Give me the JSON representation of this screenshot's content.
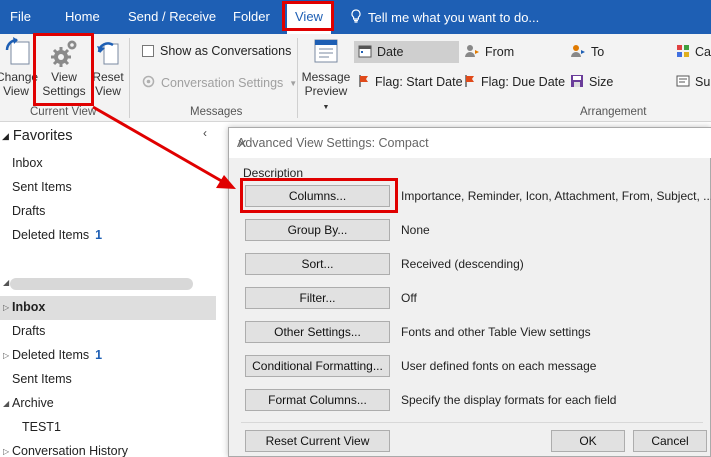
{
  "ribbon_tabs": {
    "file": "File",
    "home": "Home",
    "send_receive": "Send / Receive",
    "folder": "Folder",
    "view": "View",
    "tell_me": "Tell me what you want to do..."
  },
  "ribbon": {
    "change_view_line1": "Change",
    "change_view_line2": "View",
    "view_settings_line1": "View",
    "view_settings_line2": "Settings",
    "reset_view_line1": "Reset",
    "reset_view_line2": "View",
    "current_view_group": "Current View",
    "show_as_conversations": "Show as Conversations",
    "conversation_settings": "Conversation Settings",
    "messages_group": "Messages",
    "message_preview_line1": "Message",
    "message_preview_line2": "Preview",
    "arrangement_group": "Arrangement",
    "arrangement": {
      "date": "Date",
      "from": "From",
      "to": "To",
      "categories_partial": "Ca",
      "flag_start_date": "Flag: Start Date",
      "flag_due_date": "Flag: Due Date",
      "size": "Size",
      "subject_partial": "Su"
    }
  },
  "folders": {
    "favorites_header": "Favorites",
    "favorites": [
      {
        "name": "Inbox",
        "count": ""
      },
      {
        "name": "Sent Items",
        "count": ""
      },
      {
        "name": "Drafts",
        "count": ""
      },
      {
        "name": "Deleted Items",
        "count": "1"
      }
    ],
    "account": [
      {
        "name": "Inbox",
        "count": ""
      },
      {
        "name": "Drafts",
        "count": ""
      },
      {
        "name": "Deleted Items",
        "count": "1"
      },
      {
        "name": "Sent Items",
        "count": ""
      },
      {
        "name": "Archive",
        "count": ""
      },
      {
        "name": "TEST1",
        "count": ""
      },
      {
        "name": "Conversation History",
        "count": ""
      }
    ]
  },
  "dialog": {
    "title": "Advanced View Settings: Compact",
    "description_label": "Description",
    "rows": [
      {
        "button": "Columns...",
        "value": "Importance, Reminder, Icon, Attachment, From, Subject, ..."
      },
      {
        "button": "Group By...",
        "value": "None"
      },
      {
        "button": "Sort...",
        "value": "Received (descending)"
      },
      {
        "button": "Filter...",
        "value": "Off"
      },
      {
        "button": "Other Settings...",
        "value": "Fonts and other Table View settings"
      },
      {
        "button": "Conditional Formatting...",
        "value": "User defined fonts on each message"
      },
      {
        "button": "Format Columns...",
        "value": "Specify the display formats for each field"
      }
    ],
    "reset_button": "Reset Current View",
    "ok_button": "OK",
    "cancel_button": "Cancel"
  },
  "colors": {
    "ribbon_blue": "#1e5fb4",
    "annotation_red": "#e00000",
    "unread_count_blue": "#1e5fb4"
  }
}
